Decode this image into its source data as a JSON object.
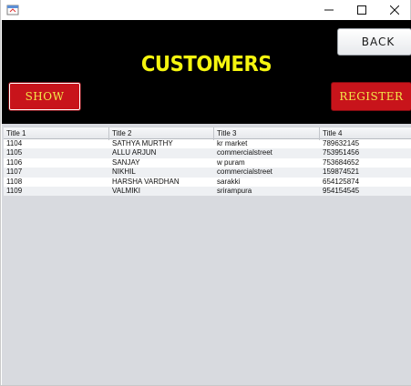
{
  "window": {
    "icon": "java-app-icon",
    "controls": [
      "minimize-icon",
      "maximize-icon",
      "close-icon"
    ]
  },
  "header": {
    "title": "CUSTOMERS",
    "back_label": "BACK",
    "show_label": "SHOW",
    "register_label": "REGISTER",
    "colors": {
      "background": "#000000",
      "title": "#f5f50f",
      "red_button": "#c8141b",
      "red_button_text": "#f3e94a"
    }
  },
  "table": {
    "columns": [
      "Title 1",
      "Title 2",
      "Title 3",
      "Title 4"
    ],
    "rows": [
      [
        "1104",
        "SATHYA MURTHY",
        "kr market",
        "789632145"
      ],
      [
        "1105",
        "ALLU ARJUN",
        "commercialstreet",
        "753951456"
      ],
      [
        "1106",
        "SANJAY",
        "w puram",
        "753684652"
      ],
      [
        "1107",
        "NIKHIL",
        "commercialstreet",
        "159874521"
      ],
      [
        "1108",
        "HARSHA VARDHAN",
        "sarakki",
        "654125874"
      ],
      [
        "1109",
        "VALMIKI",
        "srirampura",
        "954154545"
      ]
    ]
  }
}
